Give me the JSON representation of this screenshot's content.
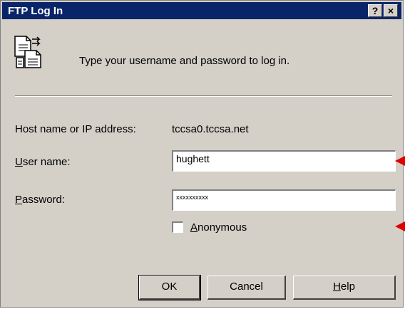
{
  "window": {
    "title": "FTP Log In",
    "help_glyph": "?",
    "close_glyph": "×"
  },
  "intro_text": "Type your username and password to log in.",
  "host": {
    "label": "Host name or IP address:",
    "value": "tccsa0.tccsa.net"
  },
  "username": {
    "label_mnemonic": "U",
    "label_rest": "ser name:",
    "value": "hughett"
  },
  "password": {
    "label_mnemonic": "P",
    "label_rest": "assword:",
    "value": "xxxxxxxxxx"
  },
  "anonymous": {
    "label_mnemonic": "A",
    "label_rest": "nonymous",
    "checked": false
  },
  "buttons": {
    "ok": "OK",
    "cancel": "Cancel",
    "help_mnemonic": "H",
    "help_rest": "elp"
  },
  "colors": {
    "title_bar": "#0a246a",
    "dialog_bg": "#d4d0c8",
    "annotation_arrow": "#e00000"
  },
  "icons": [
    "ftp-login-icon",
    "help-icon",
    "close-icon"
  ]
}
